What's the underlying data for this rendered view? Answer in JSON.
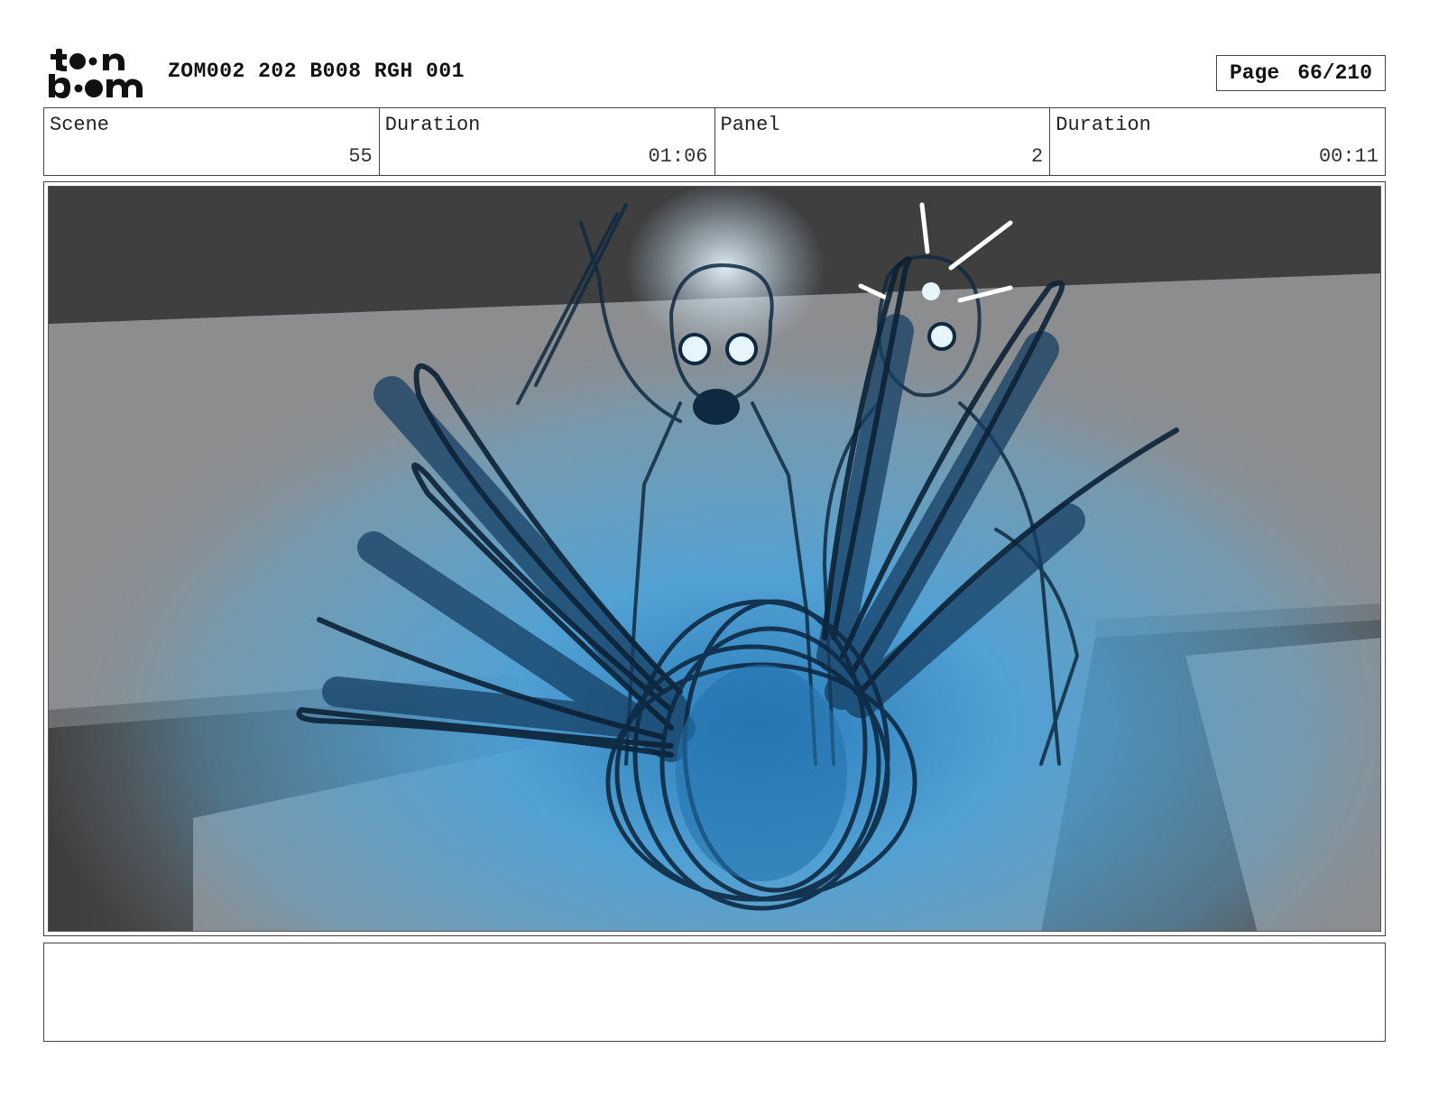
{
  "header": {
    "logo_text": "toonboom",
    "document_title": "ZOM002 202 B008 RGH 001",
    "page_label": "Page",
    "page_number": "66/210"
  },
  "info": {
    "scene_label": "Scene",
    "scene_value": "55",
    "scene_duration_label": "Duration",
    "scene_duration_value": "01:06",
    "panel_label": "Panel",
    "panel_value": "2",
    "panel_duration_label": "Duration",
    "panel_duration_value": "00:11"
  },
  "panel": {
    "colors": {
      "glow": "#4aa3dc",
      "glow_core": "#2a7ab8",
      "ceiling": "#3f3f40",
      "wall": "#8c8d8f",
      "table": "#4a4a4b",
      "ink": "#0f2a40"
    }
  },
  "notes": {
    "text": ""
  }
}
